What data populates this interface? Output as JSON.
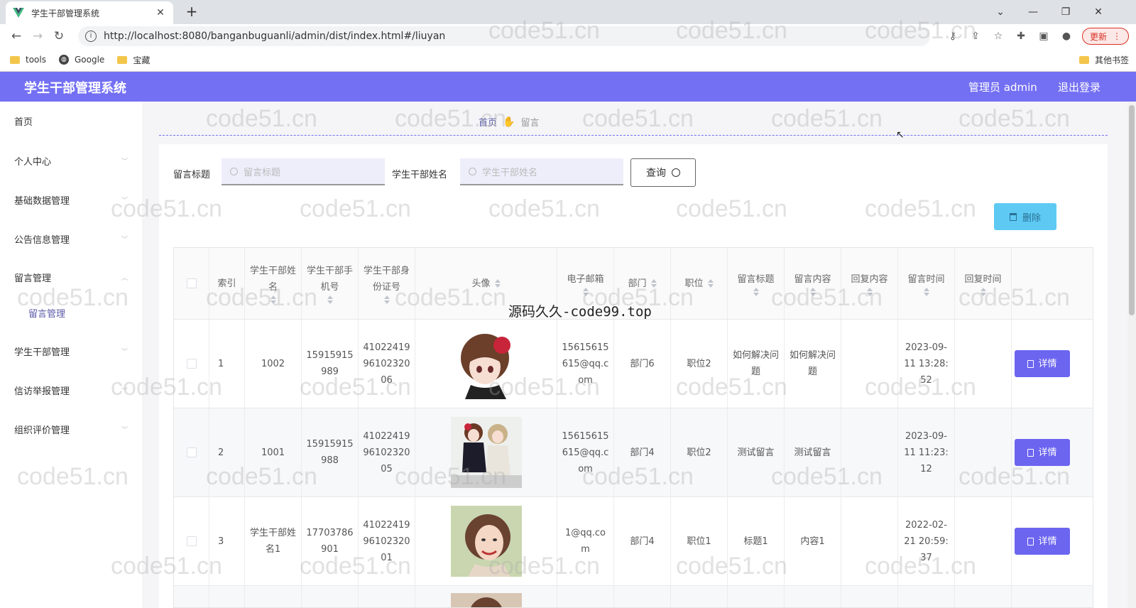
{
  "browser": {
    "tab_title": "学生干部管理系统",
    "url": "http://localhost:8080/banganbuguanli/admin/dist/index.html#/liuyan",
    "update_label": "更新",
    "bookmarks": [
      "tools",
      "Google",
      "宝藏"
    ],
    "other_bookmarks": "其他书签"
  },
  "header": {
    "title": "学生干部管理系统",
    "user": "管理员 admin",
    "logout": "退出登录"
  },
  "sidebar": {
    "items": [
      {
        "label": "首页"
      },
      {
        "label": "个人中心"
      },
      {
        "label": "基础数据管理"
      },
      {
        "label": "公告信息管理"
      },
      {
        "label": "留言管理"
      },
      {
        "label": "学生干部管理"
      },
      {
        "label": "信访举报管理"
      },
      {
        "label": "组织评价管理"
      }
    ],
    "sub_item": "留言管理"
  },
  "breadcrumb": {
    "home": "首页",
    "current": "留言"
  },
  "search": {
    "title_label": "留言标题",
    "title_placeholder": "留言标题",
    "name_label": "学生干部姓名",
    "name_placeholder": "学生干部姓名",
    "query_label": "查询",
    "delete_label": "删除"
  },
  "table": {
    "headers": {
      "index": "索引",
      "name": "学生干部姓名",
      "phone": "学生干部手机号",
      "idcard": "学生干部身份证号",
      "avatar": "头像",
      "email": "电子邮箱",
      "dept": "部门",
      "position": "职位",
      "msg_title": "留言标题",
      "msg_content": "留言内容",
      "reply_content": "回复内容",
      "msg_time": "留言时间",
      "reply_time": "回复时间"
    },
    "rows": [
      {
        "index": "1",
        "name": "1002",
        "phone": "15915915989",
        "idcard": "410224199610232006",
        "email": "15615615615@qq.com",
        "dept": "部门6",
        "position": "职位2",
        "msg_title": "如何解决问题",
        "msg_content": "如何解决问题",
        "reply_content": "",
        "msg_time": "2023-09-11 13:28:52",
        "reply_time": "",
        "action": "详情"
      },
      {
        "index": "2",
        "name": "1001",
        "phone": "15915915988",
        "idcard": "410224199610232005",
        "email": "15615615615@qq.com",
        "dept": "部门4",
        "position": "职位2",
        "msg_title": "测试留言",
        "msg_content": "测试留言",
        "reply_content": "",
        "msg_time": "2023-09-11 11:23:12",
        "reply_time": "",
        "action": "详情"
      },
      {
        "index": "3",
        "name": "学生干部姓名1",
        "phone": "17703786901",
        "idcard": "410224199610232001",
        "email": "1@qq.com",
        "dept": "部门4",
        "position": "职位1",
        "msg_title": "标题1",
        "msg_content": "内容1",
        "reply_content": "",
        "msg_time": "2022-02-21 20:59:37",
        "reply_time": "",
        "action": "详情"
      }
    ]
  },
  "overlay_text": "源码久久-code99.top",
  "watermark": "code51.cn"
}
